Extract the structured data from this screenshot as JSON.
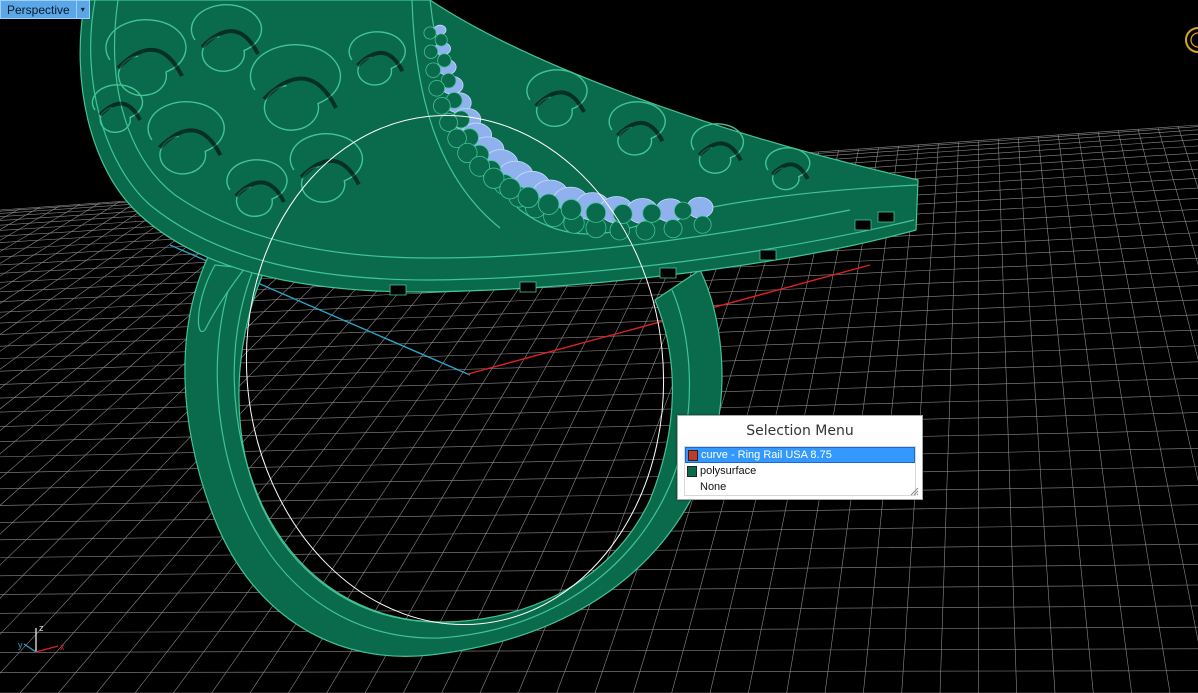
{
  "viewport": {
    "title": "Perspective",
    "menu_glyph": "▾",
    "axes": {
      "x": "x",
      "y": "y",
      "z": "z"
    },
    "colors": {
      "background": "#000000",
      "grid": "#8a8a8a",
      "x_axis": "#e02020",
      "y_axis": "#2ba3c8",
      "model": "#0a6a4c",
      "model_edge": "#42c494",
      "gems": "#8fb2ee",
      "rail_curve": "#ffffff"
    }
  },
  "selection_menu": {
    "title": "Selection Menu",
    "items": [
      {
        "label": "curve - Ring Rail USA 8.75",
        "swatch": "#c0392b",
        "selected": true
      },
      {
        "label": "polysurface",
        "swatch": "#0a6a4c",
        "selected": false
      },
      {
        "label": "None",
        "swatch": "",
        "selected": false
      }
    ]
  }
}
